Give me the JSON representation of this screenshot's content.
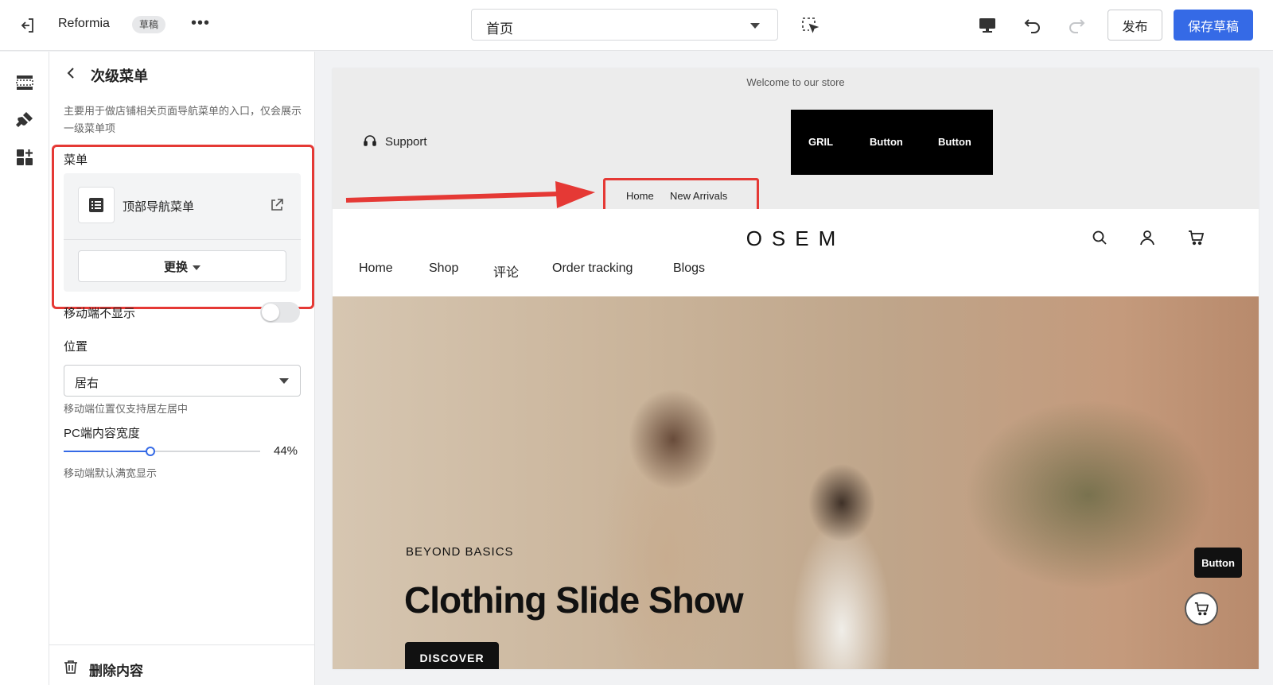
{
  "topbar": {
    "store_name": "Reformia",
    "draft_badge": "草稿",
    "more_label": "•••",
    "page_selector_value": "首页",
    "publish_label": "发布",
    "save_label": "保存草稿"
  },
  "panel": {
    "title": "次级菜单",
    "description": "主要用于做店铺相关页面导航菜单的入口，仅会展示一级菜单项",
    "menu_label": "菜单",
    "menu_name": "顶部导航菜单",
    "replace_label": "更换",
    "mobile_hide_label": "移动端不显示",
    "mobile_hide_on": false,
    "position_label": "位置",
    "position_value": "居右",
    "position_help": "移动端位置仅支持居左居中",
    "pc_width_label": "PC端内容宽度",
    "pc_width_value": "44%",
    "pc_width_fraction": 0.44,
    "pc_width_help": "移动端默认满宽显示",
    "delete_label": "删除内容"
  },
  "preview": {
    "welcome": "Welcome to our store",
    "support": "Support",
    "buttons": [
      "GRIL",
      "Button",
      "Button"
    ],
    "sub_menu": [
      "Home",
      "New Arrivals"
    ],
    "logo": "OSEM",
    "nav": [
      "Home",
      "Shop",
      "评论",
      "Order tracking",
      "Blogs"
    ],
    "hero_kicker": "BEYOND BASICS",
    "hero_title": "Clothing Slide Show",
    "hero_cta": "DISCOVER",
    "float_button": "Button"
  },
  "icons": {
    "exit": "exit-editor-icon",
    "inspect": "select-element-icon",
    "desktop": "desktop-icon",
    "undo": "undo-icon",
    "redo": "redo-icon",
    "rail": [
      "sections-icon",
      "theme-brush-icon",
      "apps-icon"
    ],
    "annotation_color": "#e53935",
    "accent_color": "#356ae6"
  }
}
